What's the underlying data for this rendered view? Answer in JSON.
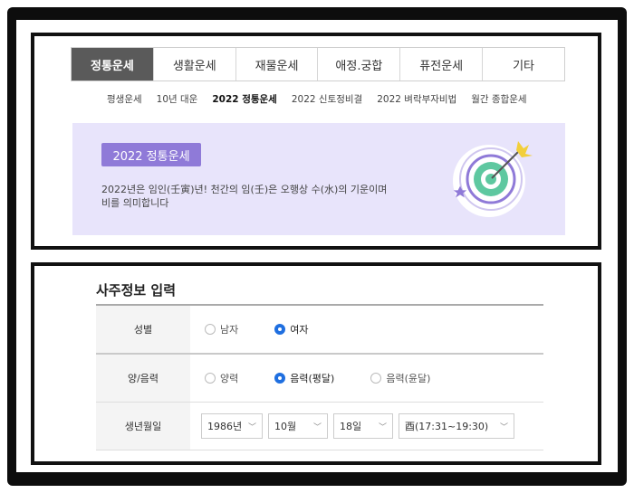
{
  "tabs": [
    {
      "label": "정통운세",
      "active": true
    },
    {
      "label": "생활운세",
      "active": false
    },
    {
      "label": "재물운세",
      "active": false
    },
    {
      "label": "애정.궁합",
      "active": false
    },
    {
      "label": "퓨전운세",
      "active": false
    },
    {
      "label": "기타",
      "active": false
    }
  ],
  "subnav": [
    {
      "label": "평생운세"
    },
    {
      "label": "10년 대운"
    },
    {
      "label": "2022 정통운세"
    },
    {
      "label": "2022 신토정비결"
    },
    {
      "label": "2022 벼락부자비법"
    },
    {
      "label": "월간 종합운세"
    }
  ],
  "banner": {
    "badge": "2022 정통운세",
    "desc_line1": "2022년은 임인(壬寅)년! 천간의 임(壬)은 오행상 수(水)의 기운이며",
    "desc_line2": "비를 의미합니다",
    "icon": "target-arrow-icon"
  },
  "form": {
    "title": "사주정보 입력",
    "gender": {
      "label": "성별",
      "options": [
        "남자",
        "여자"
      ],
      "selected": "여자"
    },
    "calendar": {
      "label": "양/음력",
      "options": [
        "양력",
        "음력(평달)",
        "음력(윤달)"
      ],
      "selected": "음력(평달)"
    },
    "birth": {
      "label": "생년월일",
      "year": "1986년",
      "month": "10월",
      "day": "18일",
      "hour": "酉(17:31~19:30)"
    }
  },
  "colors": {
    "tab_active": "#5a5a5a",
    "banner_bg": "#e8e4fb",
    "badge_bg": "#8f7ad8",
    "radio_checked": "#1f6fe0"
  }
}
